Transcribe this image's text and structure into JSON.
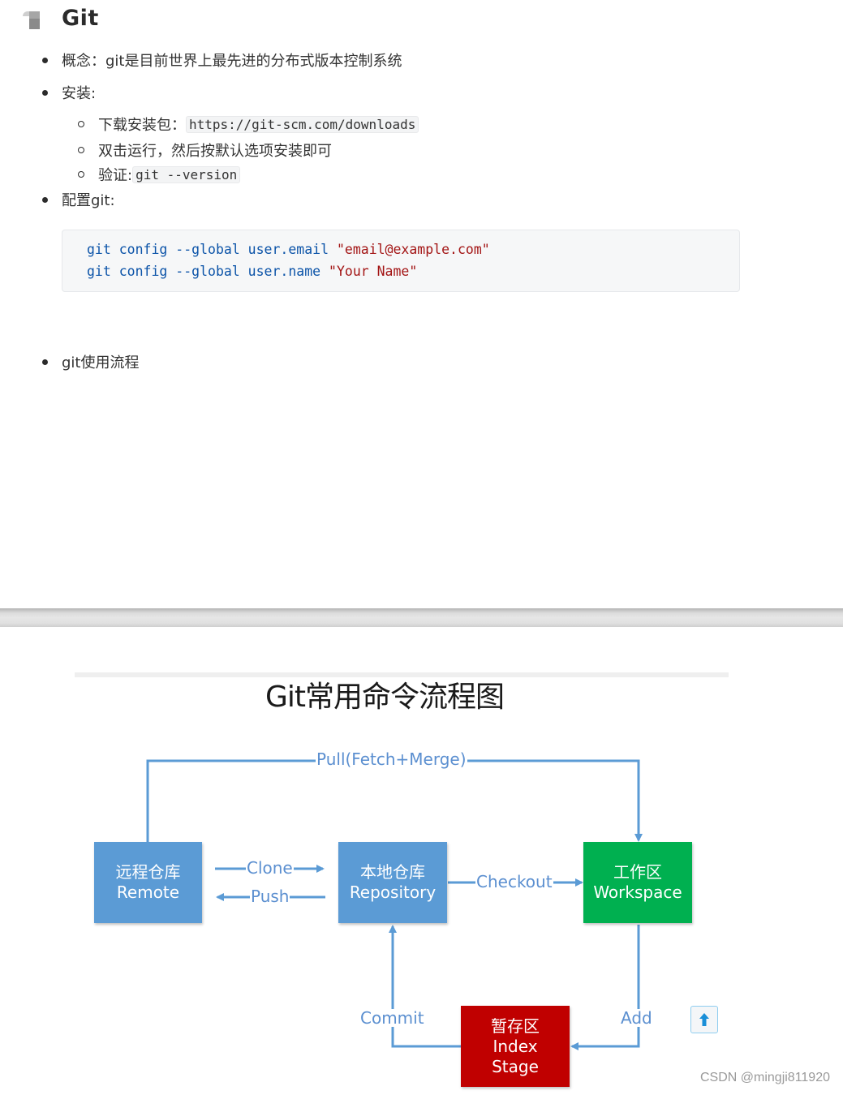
{
  "heading": {
    "title": "Git"
  },
  "items": {
    "concept": "概念：git是目前世界上最先进的分布式版本控制系统",
    "install": "安装:",
    "install_sub": {
      "download_label": "下载安装包：",
      "download_url": "https://git-scm.com/downloads",
      "run": "双击运行，然后按默认选项安装即可",
      "verify_label": "验证:",
      "verify_cmd": "git --version"
    },
    "config": "配置git:",
    "workflow": "git使用流程"
  },
  "code_block": {
    "lines": [
      {
        "cmd": "git config --global user.email ",
        "arg": "\"email@example.com\""
      },
      {
        "cmd": "git config --global user.name ",
        "arg": "\"Your Name\""
      }
    ]
  },
  "diagram": {
    "title": "Git常用命令流程图",
    "nodes": {
      "remote": {
        "cn": "远程仓库",
        "en": "Remote",
        "color": "#5b9bd5"
      },
      "repository": {
        "cn": "本地仓库",
        "en": "Repository",
        "color": "#5b9bd5"
      },
      "workspace": {
        "cn": "工作区",
        "en": "Workspace",
        "color": "#00b050"
      },
      "index": {
        "cn": "暂存区",
        "en": "Index",
        "en2": "Stage",
        "color": "#c00000"
      }
    },
    "edges": {
      "pull": "Pull(Fetch+Merge)",
      "clone": "Clone",
      "push": "Push",
      "checkout": "Checkout",
      "add": "Add",
      "commit": "Commit"
    },
    "line_color": "#5b9bd5"
  },
  "back_to_top": {
    "icon": "arrow-up-icon"
  },
  "watermark": "CSDN @mingji811920"
}
